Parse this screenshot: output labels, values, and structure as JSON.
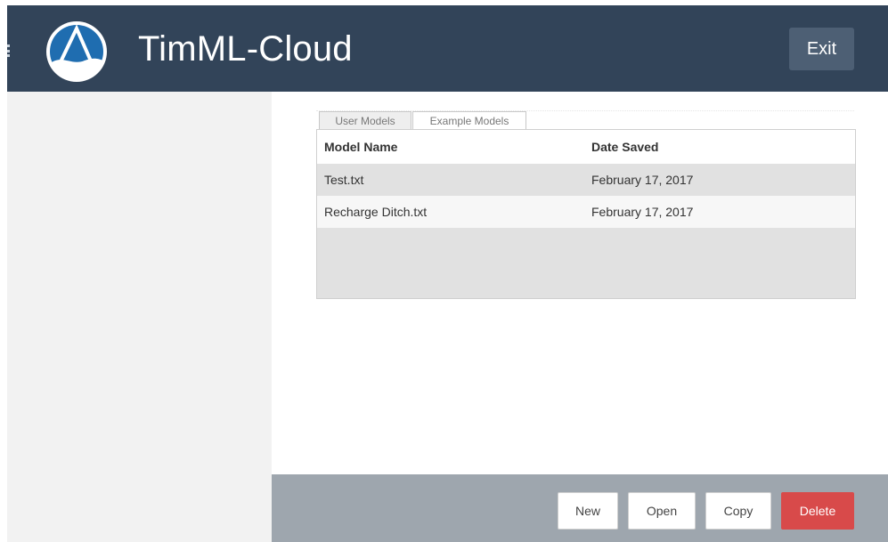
{
  "app": {
    "title": "TimML-Cloud",
    "exit_label": "Exit"
  },
  "tabs": [
    {
      "label": "User Models",
      "active": true
    },
    {
      "label": "Example Models",
      "active": false
    }
  ],
  "table": {
    "columns": [
      "Model Name",
      "Date Saved"
    ],
    "rows": [
      {
        "name": "Test.txt",
        "date": "February 17, 2017"
      },
      {
        "name": "Recharge Ditch.txt",
        "date": "February 17, 2017"
      }
    ]
  },
  "footer": {
    "buttons": {
      "new": "New",
      "open": "Open",
      "copy": "Copy",
      "delete": "Delete"
    }
  },
  "colors": {
    "header_bg": "#324459",
    "delete": "#d84a4a",
    "footer_bg": "#9ea6ae"
  },
  "icons": {
    "menu": "menu-dots-icon",
    "logo": "app-logo-icon"
  }
}
